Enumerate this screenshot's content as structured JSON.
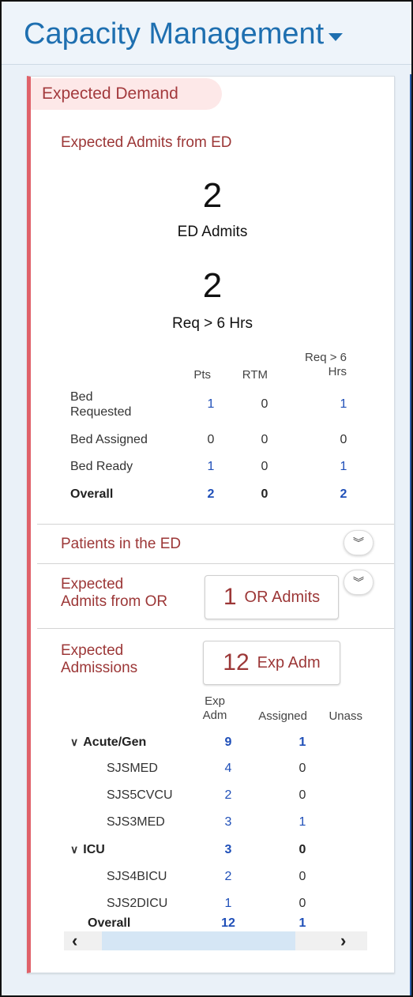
{
  "app": {
    "title": "Capacity Management"
  },
  "expected_demand": {
    "label": "Expected Demand"
  },
  "ed_admits_section": {
    "title": "Expected Admits from ED",
    "ed_admits_value": "2",
    "ed_admits_label": "ED Admits",
    "req6_value": "2",
    "req6_label": "Req > 6 Hrs",
    "headers": {
      "pts": "Pts",
      "rtm": "RTM",
      "req6_line1": "Req > 6",
      "req6_line2": "Hrs"
    },
    "rows": [
      {
        "label_line1": "Bed",
        "label_line2": "Requested",
        "pts": "1",
        "rtm": "0",
        "req6": "1"
      },
      {
        "label": "Bed Assigned",
        "pts": "0",
        "rtm": "0",
        "req6": "0"
      },
      {
        "label": "Bed Ready",
        "pts": "1",
        "rtm": "0",
        "req6": "1"
      },
      {
        "label": "Overall",
        "pts": "2",
        "rtm": "0",
        "req6": "2"
      }
    ]
  },
  "patients_in_ed": {
    "title": "Patients in the ED"
  },
  "or_admits": {
    "title_line1": "Expected",
    "title_line2": "Admits from OR",
    "value": "1",
    "label": "OR Admits"
  },
  "expected_admissions": {
    "title_line1": "Expected",
    "title_line2": "Admissions",
    "value": "12",
    "label": "Exp Adm",
    "headers": {
      "exp_line1": "Exp",
      "exp_line2": "Adm",
      "assigned": "Assigned",
      "unass": "Unass"
    },
    "groups": [
      {
        "name": "Acute/Gen",
        "exp": "9",
        "assigned": "1",
        "units": [
          {
            "name": "SJSMED",
            "exp": "4",
            "assigned": "0"
          },
          {
            "name": "SJS5CVCU",
            "exp": "2",
            "assigned": "0"
          },
          {
            "name": "SJS3MED",
            "exp": "3",
            "assigned": "1"
          }
        ]
      },
      {
        "name": "ICU",
        "exp": "3",
        "assigned": "0",
        "units": [
          {
            "name": "SJS4BICU",
            "exp": "2",
            "assigned": "0"
          },
          {
            "name": "SJS2DICU",
            "exp": "1",
            "assigned": "0"
          }
        ]
      }
    ],
    "overall": {
      "label": "Overall",
      "exp": "12",
      "assigned": "1"
    }
  },
  "icons": {
    "dropdown": "caret-down-icon",
    "expand": "double-chevron-down-icon",
    "tree_collapse": "chevron-down-icon",
    "scroll_left": "chevron-left-icon",
    "scroll_right": "chevron-right-icon"
  },
  "colors": {
    "accent_blue": "#1e6fb0",
    "section_red": "#9c3737",
    "card_border": "#e0626a",
    "link_blue": "#1f4fb8"
  }
}
